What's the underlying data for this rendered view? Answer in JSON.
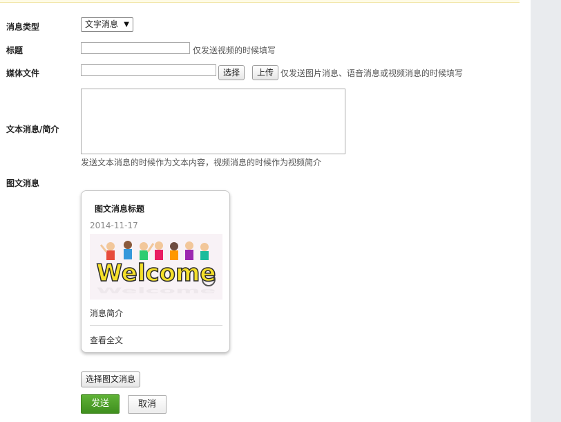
{
  "form": {
    "msg_type_label": "消息类型",
    "msg_type_value": "文字消息",
    "msg_type_caret": "▼",
    "title_label": "标题",
    "title_hint": "仅发送视频的时候填写",
    "media_label": "媒体文件",
    "choose_button": "选择",
    "upload_button": "上传",
    "media_hint": "仅发送图片消息、语音消息或视频消息的时候填写",
    "text_label": "文本消息/简介",
    "text_hint": "发送文本消息的时候作为文本内容，视频消息的时候作为视频简介",
    "news_label": "图文消息"
  },
  "news_card": {
    "title": "图文消息标题",
    "date": "2014-11-17",
    "image_text": "Welcome",
    "summary": "消息简介",
    "read_more": "查看全文"
  },
  "actions": {
    "choose_news": "选择图文消息",
    "send": "发送",
    "cancel": "取消"
  },
  "colors": {
    "send_green": "#4ea52a",
    "sidebar_gray": "#e9ebee",
    "welcome_yellow": "#f5e02a"
  }
}
